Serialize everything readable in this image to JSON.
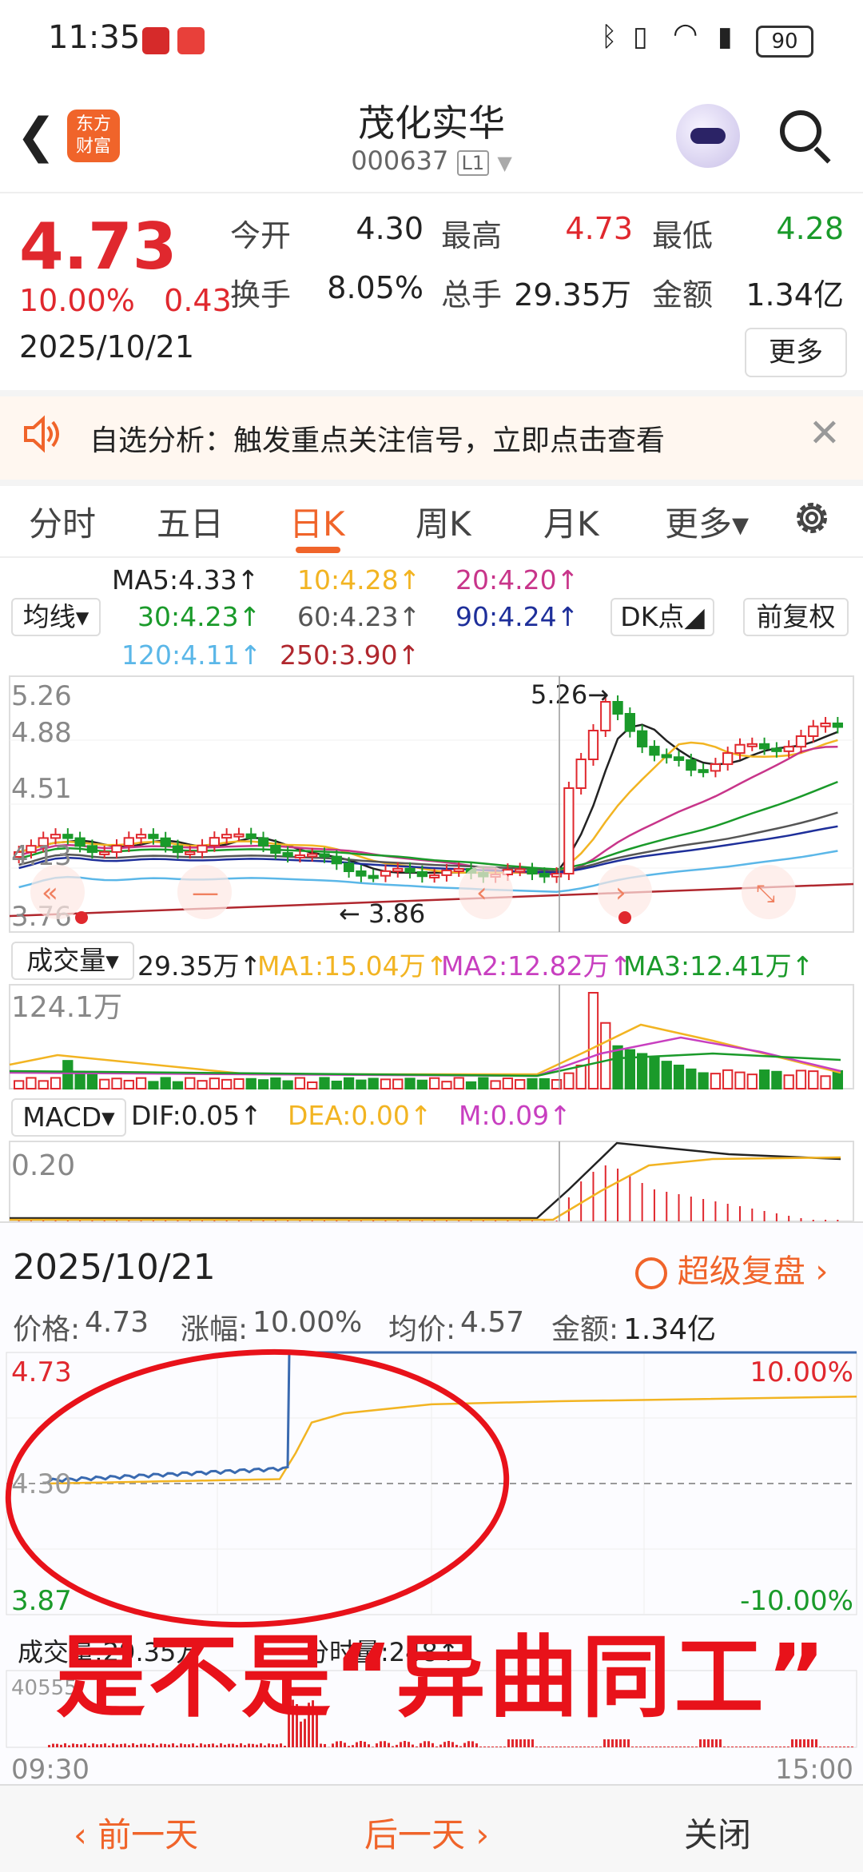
{
  "status_bar": {
    "time": "11:35",
    "battery": "90"
  },
  "header": {
    "back_icon": "chevron-left-icon",
    "logo_line1": "东方",
    "logo_line2": "财富",
    "stock_name": "茂化实华",
    "stock_code": "000637",
    "level_badge": "L1"
  },
  "quote": {
    "price": "4.73",
    "change_pct": "10.00%",
    "change_abs": "0.43",
    "date": "2025/10/21",
    "open_label": "今开",
    "open": "4.30",
    "high_label": "最高",
    "high": "4.73",
    "low_label": "最低",
    "low": "4.28",
    "turnover_label": "换手",
    "turnover": "8.05%",
    "volume_label": "总手",
    "volume": "29.35万",
    "amount_label": "金额",
    "amount": "1.34亿",
    "more_label": "更多"
  },
  "alert": {
    "text": "自选分析：触发重点关注信号，立即点击查看",
    "close": "✕"
  },
  "tabs": [
    {
      "label": "分时"
    },
    {
      "label": "五日"
    },
    {
      "label": "日K",
      "active": true
    },
    {
      "label": "周K"
    },
    {
      "label": "月K"
    },
    {
      "label": "更多▾"
    }
  ],
  "ma_legend": {
    "selector": "均线▾",
    "ma5": "MA5:4.33↑",
    "ma10": "10:4.28↑",
    "ma20": "20:4.20↑",
    "ma30": "30:4.23↑",
    "ma60": "60:4.23↑",
    "ma90": "90:4.24↑",
    "ma120": "120:4.11↑",
    "ma250": "250:3.90↑",
    "dk_button": "DK点◢",
    "adjust_button": "前复权"
  },
  "kline": {
    "y_labels": [
      "5.26",
      "4.88",
      "4.51",
      "4.13",
      "3.76"
    ],
    "high_annotation": "5.26→",
    "low_annotation": "← 3.86"
  },
  "volume_legend": {
    "selector": "成交量▾",
    "vol": "29.35万↑",
    "ma1": "MA1:15.04万↑",
    "ma2": "MA2:12.82万↑",
    "ma3": "MA3:12.41万↑",
    "max_label": "124.1万"
  },
  "macd_legend": {
    "selector": "MACD▾",
    "dif": "DIF:0.05↑",
    "dea": "DEA:0.00↑",
    "m": "M:0.09↑",
    "max_label": "0.20"
  },
  "intraday": {
    "date": "2025/10/21",
    "replay": "超级复盘 ›",
    "price_label": "价格:",
    "price": "4.73",
    "chg_label": "涨幅:",
    "chg": "10.00%",
    "avg_label": "均价:",
    "avg": "4.57",
    "amount_label": "金额:",
    "amount": "1.34亿",
    "y_top": "4.73",
    "y_mid": "4.30",
    "y_bot": "3.87",
    "pct_top": "10.00%",
    "pct_bot": "-10.00%",
    "vol_label": "成交量:29.35万",
    "tick_vol": "分时量:248↑",
    "vol_max": "40555",
    "t_start": "09:30",
    "t_end": "15:00"
  },
  "overlay_caption": "是不是“异曲同工”",
  "footer": {
    "prev": "‹ 前一天",
    "next": "后一天 ›",
    "close": "关闭"
  },
  "colors": {
    "up": "#e0282e",
    "down": "#1a9a2a",
    "accent": "#f0642a"
  }
}
